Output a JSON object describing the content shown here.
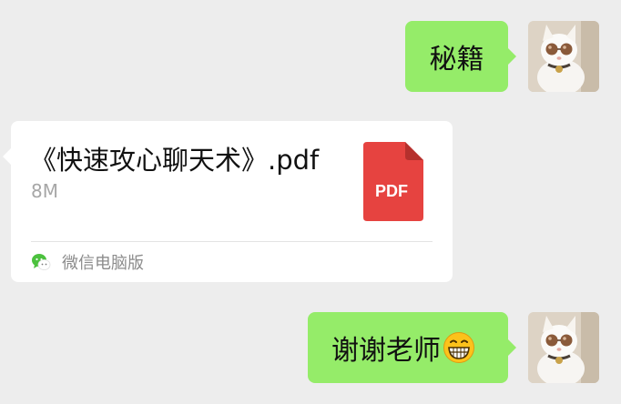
{
  "messages": [
    {
      "side": "right",
      "type": "text",
      "text": "秘籍",
      "avatar_icon": "cat-avatar-icon"
    },
    {
      "side": "left",
      "type": "file",
      "file": {
        "name": "《快速攻心聊天术》.pdf",
        "size": "8M",
        "icon": "pdf-file-icon",
        "icon_label": "PDF",
        "icon_color": "#e64340"
      },
      "source": {
        "icon": "wechat-icon",
        "label": "微信电脑版"
      }
    },
    {
      "side": "right",
      "type": "text",
      "text": "谢谢老师",
      "emoji": "grinning-face-emoji",
      "avatar_icon": "cat-avatar-icon"
    }
  ],
  "colors": {
    "background": "#ededed",
    "sent_bubble": "#95ec69",
    "received_bubble": "#ffffff",
    "secondary_text": "#a7a7a7",
    "wechat_green": "#4cc13e"
  }
}
